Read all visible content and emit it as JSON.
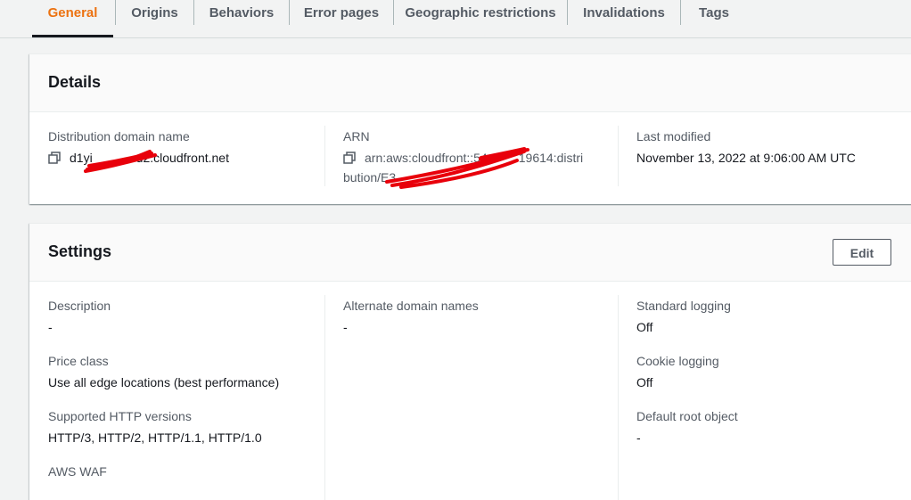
{
  "tabs": [
    {
      "label": "General",
      "active": true
    },
    {
      "label": "Origins"
    },
    {
      "label": "Behaviors"
    },
    {
      "label": "Error pages"
    },
    {
      "label": "Geographic restrictions"
    },
    {
      "label": "Invalidations"
    },
    {
      "label": "Tags"
    }
  ],
  "details": {
    "title": "Details",
    "domain_label": "Distribution domain name",
    "domain_value": "d1yi       d2.cloudfront.net",
    "arn_label": "ARN",
    "arn_line1": "arn:aws:cloudfront::54     19614:distri",
    "arn_line2": "bution/E3",
    "modified_label": "Last modified",
    "modified_value": "November 13, 2022 at 9:06:00 AM UTC"
  },
  "settings": {
    "title": "Settings",
    "edit_label": "Edit",
    "description_label": "Description",
    "description_value": "-",
    "price_label": "Price class",
    "price_value": "Use all edge locations (best performance)",
    "http_label": "Supported HTTP versions",
    "http_value": "HTTP/3, HTTP/2, HTTP/1.1, HTTP/1.0",
    "waf_label": "AWS WAF",
    "alternate_label": "Alternate domain names",
    "alternate_value": "-",
    "logging_label": "Standard logging",
    "logging_value": "Off",
    "cookie_label": "Cookie logging",
    "cookie_value": "Off",
    "root_label": "Default root object",
    "root_value": "-"
  },
  "colors": {
    "accent": "#ec7211",
    "redaction": "#e8000b"
  }
}
